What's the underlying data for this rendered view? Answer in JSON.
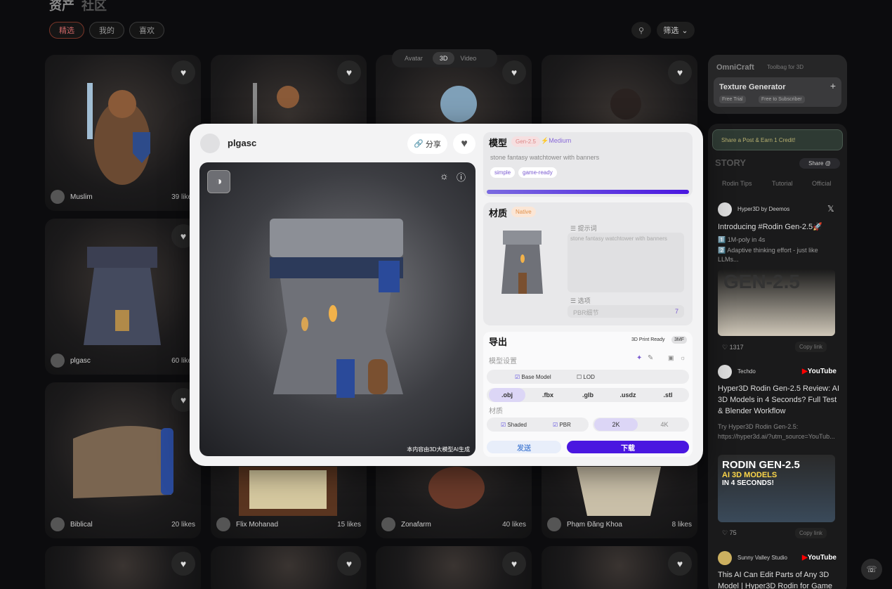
{
  "header": {
    "tab_assets": "资产",
    "tab_community": "社区"
  },
  "filters": {
    "featured": "精选",
    "mine": "我的",
    "liked": "喜欢",
    "sort": "筛选"
  },
  "view_toggle": {
    "avatar": "Avatar",
    "three_d": "3D",
    "video": "Video"
  },
  "cards": [
    {
      "user": "Muslim",
      "likes": "39 likes"
    },
    {
      "user": "plgasc",
      "likes": "60 likes"
    },
    {
      "user": "Biblical",
      "likes": "20 likes"
    },
    {
      "user": "Flix Mohanad",
      "likes": "15 likes"
    },
    {
      "user": "Zonafarm",
      "likes": "40 likes"
    },
    {
      "user": "Phạm Đăng Khoa",
      "likes": "8 likes"
    }
  ],
  "sidebar": {
    "brand": "OmniCraft",
    "brand_sub": "Toolbag for 3D",
    "tool": "Texture Generator",
    "trial": "Free Trial",
    "subscriber": "Free to Subscriber",
    "share_banner": "Share a Post & Earn 1 Credit!",
    "story": "STORY",
    "share_btn": "Share @",
    "story_tabs": [
      "Rodin Tips",
      "Tutorial",
      "Official"
    ],
    "post1": {
      "author": "Hyper3D by Deemos",
      "title": "Introducing #Rodin Gen-2.5🚀",
      "line1": "1️⃣ 1M-poly in 4s",
      "line2": "2️⃣ Adaptive thinking effort - just like LLMs...",
      "img_text": "GEN-2.5",
      "likes": "1317",
      "copy": "Copy link"
    },
    "post2": {
      "author": "Techdo",
      "source": "YouTube",
      "title": "Hyper3D Rodin Gen-2.5 Review: AI 3D Models in 4 Seconds? Full Test & Blender Workflow",
      "desc": "Try Hyper3D Rodin Gen-2.5: https://hyper3d.ai/?utm_source=YouTub...",
      "thumb1": "RODIN GEN-2.5",
      "thumb2": "AI 3D MODELS",
      "thumb3": "IN 4 SECONDS!",
      "likes": "75",
      "copy": "Copy link"
    },
    "post3": {
      "author": "Sunny Valley Studio",
      "source": "YouTube",
      "title": "This AI Can Edit Parts of Any 3D Model | Hyper3D Rodin for Game"
    }
  },
  "modal": {
    "user": "plgasc",
    "share": "分享",
    "watermark": "本内容由3D大模型AI生成",
    "model": {
      "title": "模型",
      "gen": "Gen-2.5",
      "quality": "Medium",
      "prompt": "stone fantasy watchtower with banners",
      "tags": [
        "simple",
        "game-ready"
      ]
    },
    "material": {
      "title": "材质",
      "native": "Native",
      "prompt_label": "提示词",
      "prompt": "stone fantasy watchtower with banners",
      "options_label": "选项",
      "pbr": "PBR细节",
      "pbr_val": "7"
    },
    "export": {
      "title": "导出",
      "print_ready": "3D Print Ready",
      "threemf": "3MF",
      "model_settings": "模型设置",
      "base_model": "Base Model",
      "lod": "LOD",
      "formats": [
        ".obj",
        ".fbx",
        ".glb",
        ".usdz",
        ".stl"
      ],
      "material_label": "材质",
      "shaded": "Shaded",
      "pbr": "PBR",
      "res": [
        "2K",
        "4K"
      ],
      "send": "发送",
      "download": "下载"
    }
  },
  "colors": {
    "accent": "#4a17e0",
    "tag_bg": "#ece6ff"
  }
}
